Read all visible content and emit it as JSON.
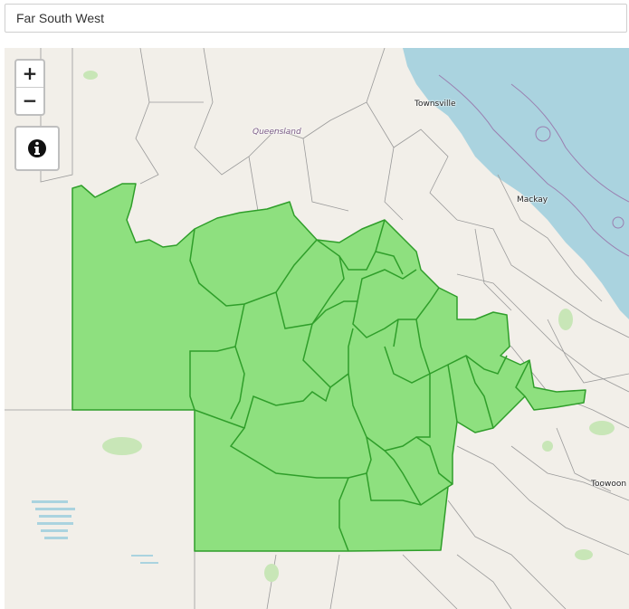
{
  "search": {
    "value": "Far South West"
  },
  "map": {
    "zoom_in_label": "+",
    "zoom_out_label": "−",
    "info_icon": "info-circle-icon",
    "place_labels": {
      "townsville": "Townsville",
      "mackay": "Mackay",
      "toowoomba": "Toowoon",
      "queensland": "Queensland"
    },
    "colors": {
      "land": "#f2efe9",
      "water": "#aad3df",
      "highlight_fill": "#8ee07f",
      "highlight_stroke": "#2f9e2a",
      "boundary": "#9a9a9a"
    }
  }
}
